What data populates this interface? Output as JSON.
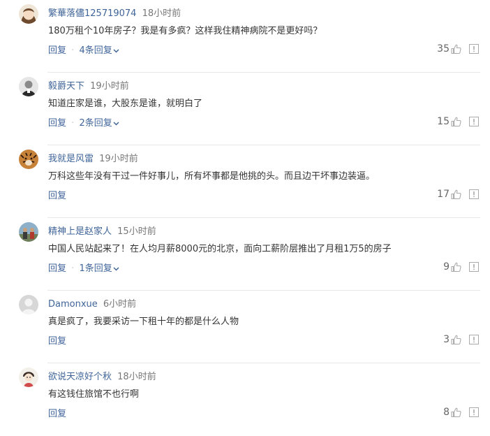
{
  "labels": {
    "reply": "回复",
    "separator": "·"
  },
  "comments": [
    {
      "username": "繁華落儘125719074",
      "time": "18小时前",
      "content": "180万租个10年房子？我是有多疯？这样我住精神病院不是更好吗？",
      "replies": "4条回复",
      "likes": "35"
    },
    {
      "username": "毅爵天下",
      "time": "19小时前",
      "content": "知道庄家是谁，大股东是谁，就明白了",
      "replies": "2条回复",
      "likes": "15"
    },
    {
      "username": "我就是风雷",
      "time": "19小时前",
      "content": "万科这些年没有干过一件好事儿，所有坏事都是他挑的头。而且边干坏事边装逼。",
      "replies": "",
      "likes": "17"
    },
    {
      "username": "精神上是赵家人",
      "time": "15小时前",
      "content": "中国人民站起来了！在人均月薪8000元的北京，面向工薪阶层推出了月租1万5的房子",
      "replies": "1条回复",
      "likes": "9"
    },
    {
      "username": "Damonxue",
      "time": "6小时前",
      "content": "真是疯了，我要采访一下租十年的都是什么人物",
      "replies": "",
      "likes": "3"
    },
    {
      "username": "欲说天凉好个秋",
      "time": "18小时前",
      "content": "有这钱住旅馆不也行啊",
      "replies": "",
      "likes": "8"
    }
  ],
  "colors": {
    "username": "#406599",
    "action": "#406599",
    "text": "#333333",
    "meta": "#777777",
    "divider": "#e8e8e8"
  },
  "icons": {
    "like": "thumbs-up-icon",
    "report": "report-icon",
    "expand": "chevron-down-icon"
  }
}
